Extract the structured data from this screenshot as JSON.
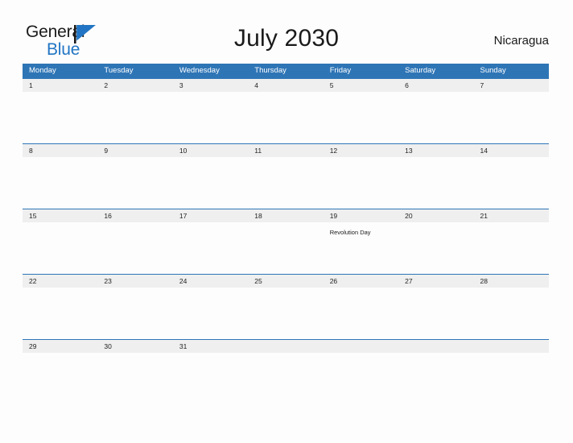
{
  "logo": {
    "word_one": "General",
    "word_two": "Blue",
    "flag_icon": "blue-triangle-flag",
    "brand_blue": "#2175c4"
  },
  "header": {
    "title": "July 2030",
    "country": "Nicaragua"
  },
  "theme": {
    "header_blue": "#2e75b6",
    "band_gray": "#efefef",
    "page_background": "#fdfdfd",
    "text_dark": "#1a1a1a"
  },
  "calendar": {
    "weekdays": [
      "Monday",
      "Tuesday",
      "Wednesday",
      "Thursday",
      "Friday",
      "Saturday",
      "Sunday"
    ],
    "weeks": [
      {
        "days": [
          {
            "date": "1",
            "event": ""
          },
          {
            "date": "2",
            "event": ""
          },
          {
            "date": "3",
            "event": ""
          },
          {
            "date": "4",
            "event": ""
          },
          {
            "date": "5",
            "event": ""
          },
          {
            "date": "6",
            "event": ""
          },
          {
            "date": "7",
            "event": ""
          }
        ]
      },
      {
        "days": [
          {
            "date": "8",
            "event": ""
          },
          {
            "date": "9",
            "event": ""
          },
          {
            "date": "10",
            "event": ""
          },
          {
            "date": "11",
            "event": ""
          },
          {
            "date": "12",
            "event": ""
          },
          {
            "date": "13",
            "event": ""
          },
          {
            "date": "14",
            "event": ""
          }
        ]
      },
      {
        "days": [
          {
            "date": "15",
            "event": ""
          },
          {
            "date": "16",
            "event": ""
          },
          {
            "date": "17",
            "event": ""
          },
          {
            "date": "18",
            "event": ""
          },
          {
            "date": "19",
            "event": "Revolution Day"
          },
          {
            "date": "20",
            "event": ""
          },
          {
            "date": "21",
            "event": ""
          }
        ]
      },
      {
        "days": [
          {
            "date": "22",
            "event": ""
          },
          {
            "date": "23",
            "event": ""
          },
          {
            "date": "24",
            "event": ""
          },
          {
            "date": "25",
            "event": ""
          },
          {
            "date": "26",
            "event": ""
          },
          {
            "date": "27",
            "event": ""
          },
          {
            "date": "28",
            "event": ""
          }
        ]
      },
      {
        "days": [
          {
            "date": "29",
            "event": ""
          },
          {
            "date": "30",
            "event": ""
          },
          {
            "date": "31",
            "event": ""
          },
          {
            "date": "",
            "event": ""
          },
          {
            "date": "",
            "event": ""
          },
          {
            "date": "",
            "event": ""
          },
          {
            "date": "",
            "event": ""
          }
        ]
      }
    ]
  }
}
